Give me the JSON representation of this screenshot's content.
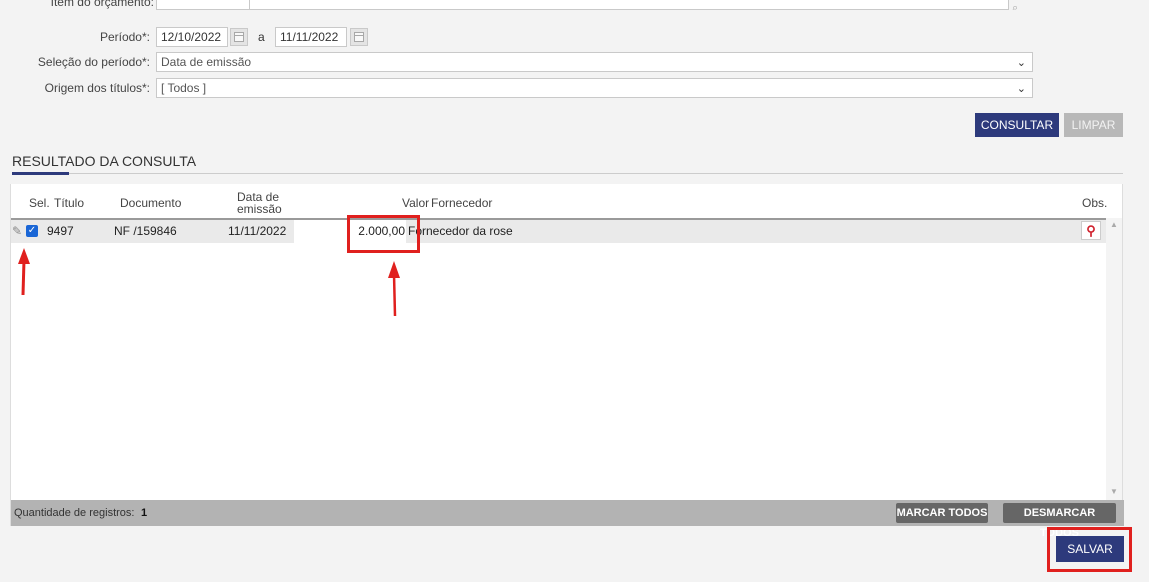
{
  "form": {
    "budget_item_label": "Item do orçamento:",
    "period_label": "Período*:",
    "period_start": "12/10/2022",
    "period_sep": "a",
    "period_end": "11/11/2022",
    "period_selection_label": "Seleção do período*:",
    "period_selection_value": "Data de emissão",
    "origin_label": "Origem dos títulos*:",
    "origin_value": "[ Todos ]",
    "consult_label": "CONSULTAR",
    "clear_label": "LIMPAR"
  },
  "result": {
    "title": "RESULTADO DA CONSULTA",
    "columns": {
      "sel": "Sel.",
      "titulo": "Título",
      "documento": "Documento",
      "data_line1": "Data de",
      "data_line2": "emissão",
      "valor": "Valor",
      "fornecedor": "Fornecedor",
      "obs": "Obs."
    },
    "rows": [
      {
        "titulo": "9497",
        "documento": "NF /159846",
        "data": "11/11/2022",
        "valor": "2.000,00",
        "fornecedor": "Fornecedor da rose",
        "checked": true
      }
    ],
    "count_label": "Quantidade de registros:",
    "count_value": "1",
    "mark_all_label": "MARCAR TODOS",
    "unmark_all_label": "DESMARCAR TODOS",
    "save_label": "SALVAR"
  },
  "colors": {
    "accent": "#2d3a7c",
    "annotation": "#e0201e"
  }
}
